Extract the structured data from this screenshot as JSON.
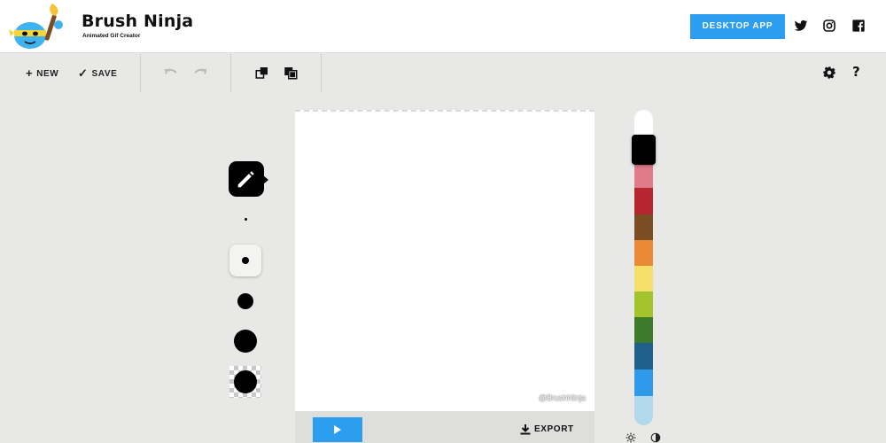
{
  "app": {
    "title": "Brush Ninja",
    "subtitle": "Animated Gif Creator"
  },
  "header": {
    "desktop_app_label": "DESKTOP APP",
    "social_icons": [
      "twitter-icon",
      "instagram-icon",
      "facebook-icon"
    ]
  },
  "toolbar": {
    "new_label": "NEW",
    "save_label": "SAVE",
    "new_glyph": "+",
    "save_glyph": "✓",
    "icons": [
      "undo-icon",
      "redo-icon",
      "onion-skin-icon",
      "layers-icon",
      "settings-icon",
      "help-icon"
    ],
    "help_glyph": "?"
  },
  "brushes": {
    "active_tool": "pencil-icon",
    "sizes": [
      "tiny",
      "small",
      "medium",
      "large",
      "eraser"
    ],
    "selected_size": "small"
  },
  "canvas": {
    "watermark": "@BrushNinja"
  },
  "frame_bar": {
    "export_label": "EXPORT"
  },
  "palette": {
    "colors": [
      "#ffffff",
      "#000000",
      "#e07b8b",
      "#b7262f",
      "#7a4d24",
      "#eb8a36",
      "#f6df6a",
      "#a3c42c",
      "#3d7a2c",
      "#1f5f8a",
      "#2f9aea",
      "#b2d8ec"
    ],
    "selected": "#000000",
    "icons": [
      "brightness-icon",
      "contrast-icon"
    ]
  },
  "colors": {
    "accent": "#2b9ef0",
    "background": "#e8e8e6"
  }
}
